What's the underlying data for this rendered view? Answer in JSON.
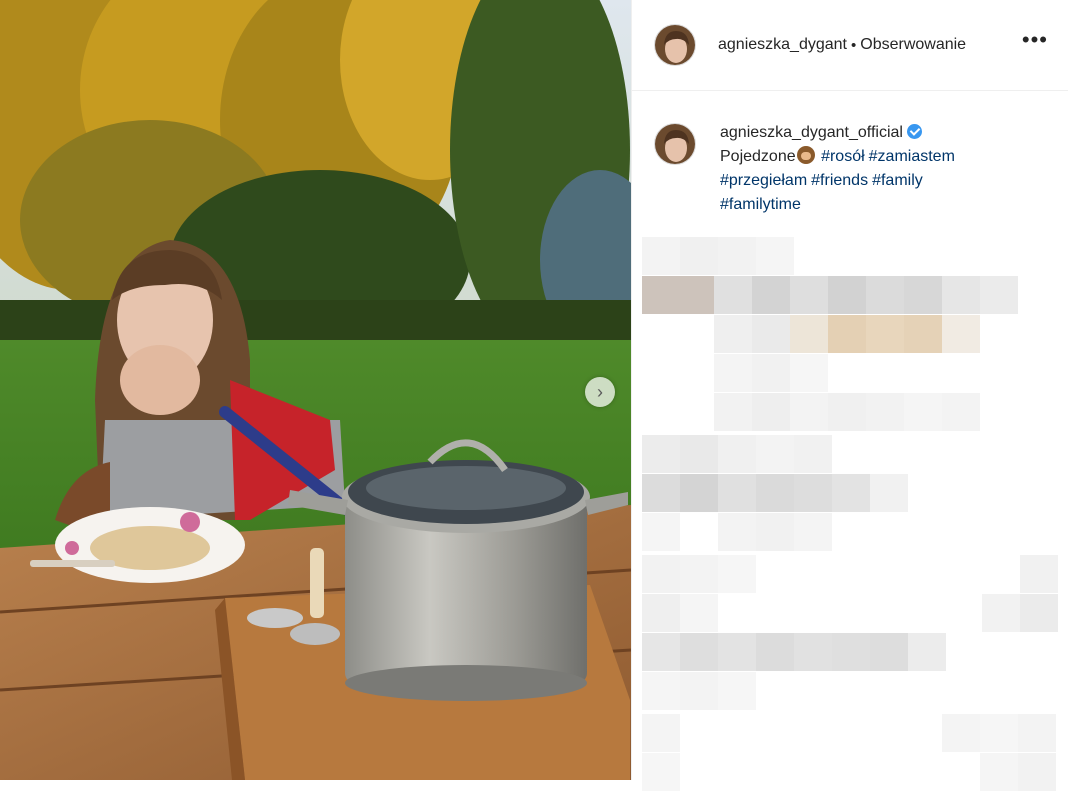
{
  "header": {
    "username": "agnieszka_dygant",
    "separator": "•",
    "follow_status": "Obserwowanie",
    "more_label": "•••"
  },
  "caption": {
    "username": "agnieszka_dygant_official",
    "text": "Pojedzone",
    "emoji": "see-no-evil-monkey",
    "hashtags": [
      "#rosół",
      "#zamiastem",
      "#przegiełam",
      "#friends",
      "#family",
      "#familytime"
    ]
  },
  "photo": {
    "description_icon": "photo",
    "next_arrow": "›"
  },
  "colors": {
    "link": "#003569",
    "verified": "#3897f0",
    "divider": "#efefef"
  }
}
